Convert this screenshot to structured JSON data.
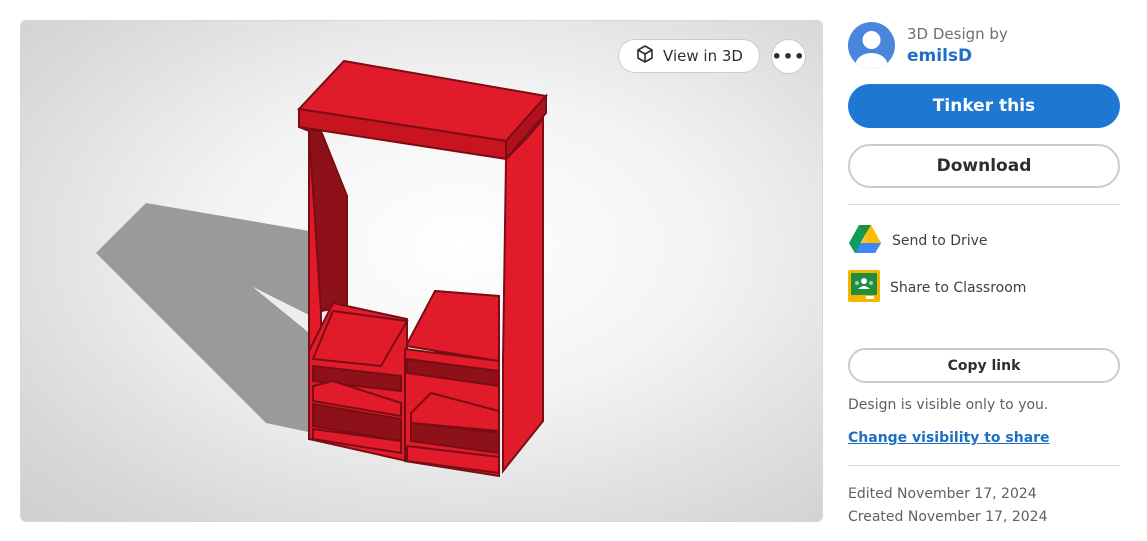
{
  "viewer": {
    "view3d_label": "View in 3D",
    "more_label": "•••"
  },
  "author": {
    "byline": "3D Design by",
    "username": "emilsD"
  },
  "actions": {
    "tinker_label": "Tinker this",
    "download_label": "Download"
  },
  "share": {
    "drive_label": "Send to Drive",
    "classroom_label": "Share to Classroom",
    "copy_link_label": "Copy link"
  },
  "visibility": {
    "text": "Design is visible only to you.",
    "link": "Change visibility to share"
  },
  "dates": {
    "edited": "Edited November 17, 2024",
    "created": "Created November 17, 2024"
  },
  "colors": {
    "model_red": "#e21b2b",
    "model_dark": "#8e1018",
    "primary_blue": "#1f77d4",
    "link_blue": "#1f6fc6"
  }
}
